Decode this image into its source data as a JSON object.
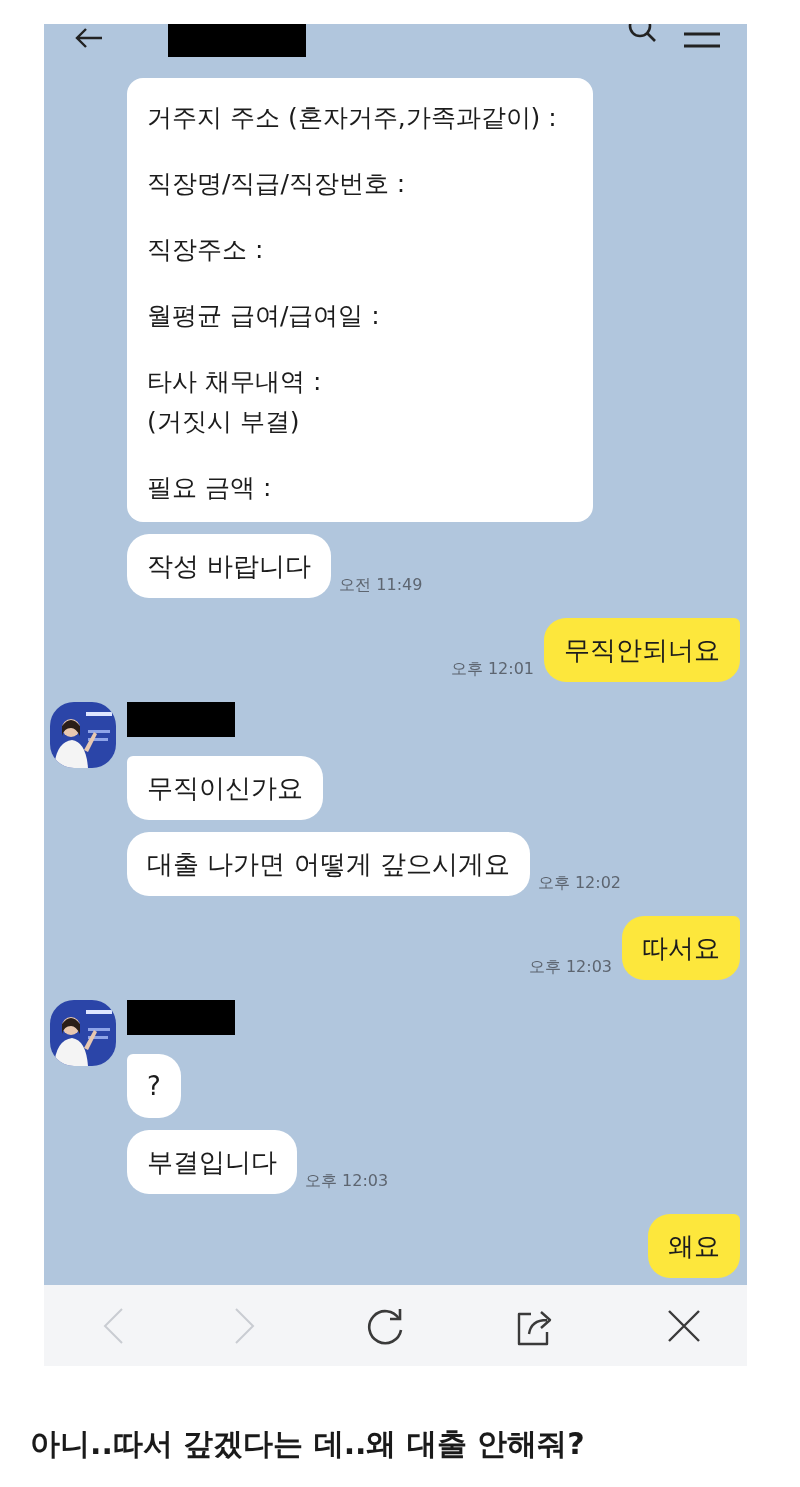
{
  "messages": [
    {
      "kind": "form",
      "paragraphs": [
        "거주지 주소 (혼자거주,가족과같이) :",
        "직장명/직급/직장번호 :",
        "직장주소 :",
        "월평균 급여/급여일 :",
        "타사 채무내역 :\n(거짓시 부결)",
        "필요 금액 :"
      ]
    },
    {
      "kind": "received",
      "show_profile": false,
      "text": "작성 바랍니다",
      "time": "오전 11:49"
    },
    {
      "kind": "sent",
      "text": "무직안되너요",
      "time": "오후 12:01"
    },
    {
      "kind": "received",
      "show_profile": true,
      "text": "무직이신가요"
    },
    {
      "kind": "received",
      "show_profile": false,
      "text": "대출 나가면 어떻게 갚으시게요",
      "time": "오후 12:02"
    },
    {
      "kind": "sent",
      "text": "따서요",
      "time": "오후 12:03"
    },
    {
      "kind": "received",
      "show_profile": true,
      "text": "?"
    },
    {
      "kind": "received",
      "show_profile": false,
      "text": "부결입니다",
      "time": "오후 12:03"
    },
    {
      "kind": "sent",
      "text": "왜요"
    }
  ],
  "toolbar": [
    {
      "kind": "back",
      "disabled": true
    },
    {
      "kind": "forward",
      "disabled": true
    },
    {
      "kind": "reload",
      "disabled": false
    },
    {
      "kind": "share",
      "disabled": false
    },
    {
      "kind": "close",
      "disabled": false
    }
  ],
  "caption": "아니..따서 갚겠다는 데..왜 대출 안해줘?"
}
